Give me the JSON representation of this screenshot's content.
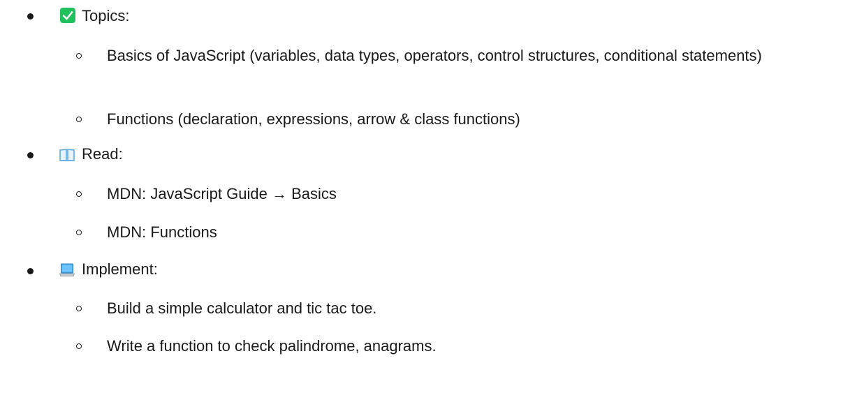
{
  "sections": [
    {
      "icon": "check-mark-button-icon",
      "label": "Topics:",
      "items": [
        "Basics of JavaScript (variables, data types, operators, control structures, conditional statements)",
        "Functions (declaration, expressions, arrow & class functions)"
      ]
    },
    {
      "icon": "open-book-icon",
      "label": "Read:",
      "items": [
        "MDN: JavaScript Guide → Basics",
        "MDN: Functions"
      ]
    },
    {
      "icon": "laptop-icon",
      "label": "Implement:",
      "items": [
        "Build a simple calculator and tic tac toe.",
        "Write a function to check palindrome, anagrams."
      ]
    }
  ],
  "colors": {
    "text": "#1a1a1a",
    "check_green": "#20c05c",
    "book_blue": "#5aa9e6",
    "laptop_blue": "#3fa9f5"
  }
}
